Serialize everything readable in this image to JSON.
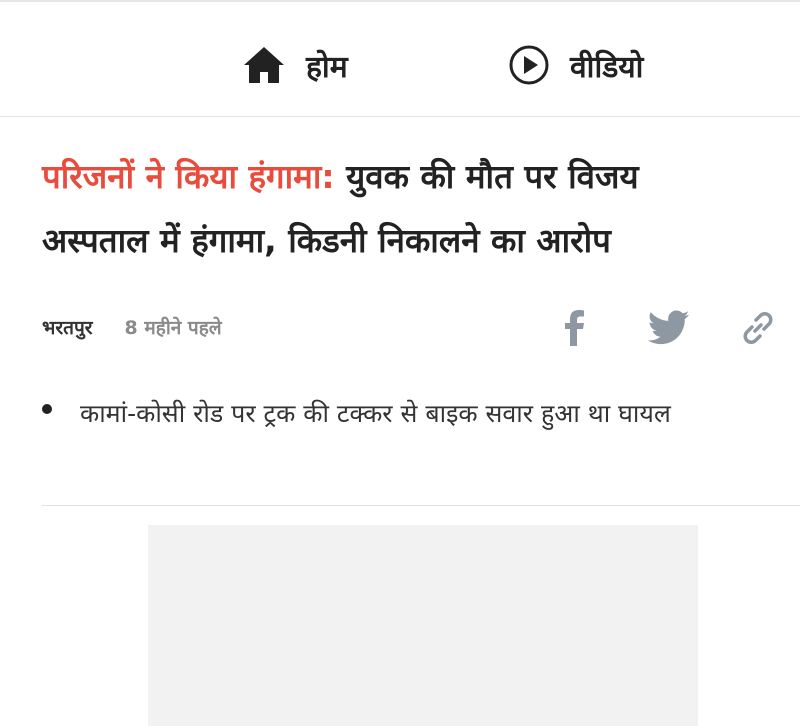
{
  "nav": {
    "items": [
      {
        "label": "होम",
        "icon": "home-icon"
      },
      {
        "label": "वीडियो",
        "icon": "play-circle-icon"
      }
    ]
  },
  "article": {
    "headline_highlight": "परिजनों ने किया हंगामा:",
    "headline_rest_line1": "युवक की मौत पर विजय",
    "headline_line2": "अस्पताल में हंगामा, किडनी निकालने का आरोप",
    "city": "भरतपुर",
    "time": "8 महीने पहले",
    "bullet": "कामां-कोसी रोड पर ट्रक की टक्कर से बाइक सवार हुआ था घायल"
  },
  "share": {
    "icons": [
      "facebook-icon",
      "twitter-icon",
      "link-icon"
    ]
  },
  "colors": {
    "highlight": "#e74c3c",
    "icon_gray": "#8e98a3",
    "text": "#222222"
  }
}
